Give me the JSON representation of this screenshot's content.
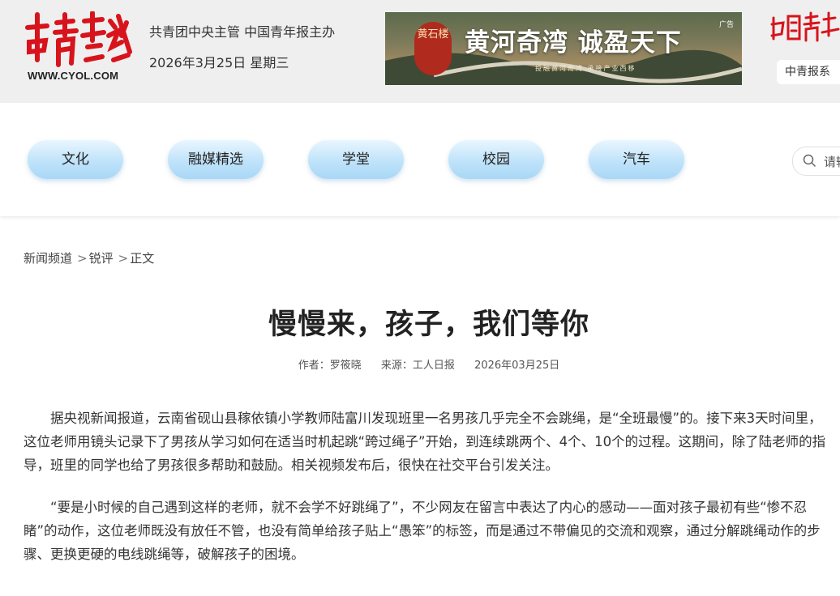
{
  "header": {
    "logo_url": "WWW.CYOL.COM",
    "org_line": "共青团中央主管 中国青年报主办",
    "date_line": "2026年3月25日 星期三",
    "banner": {
      "title": "黄河奇湾 诚盈天下",
      "ad_label": "广告",
      "subtitle": "投融黄河奇湾  承接产业西移",
      "seal_text": "黄石楼"
    },
    "partner_button": "中青报系"
  },
  "nav": {
    "items": [
      "文化",
      "融媒精选",
      "学堂",
      "校园",
      "汽车"
    ],
    "search_placeholder": "请输"
  },
  "breadcrumb": {
    "items": [
      "新闻频道",
      "锐评",
      "正文"
    ],
    "separator": ">"
  },
  "article": {
    "title": "慢慢来，孩子，我们等你",
    "author": "作者：罗筱晓",
    "source": "来源：工人日报",
    "date": "2026年03月25日",
    "paragraphs": [
      "据央视新闻报道，云南省砚山县稼依镇小学教师陆富川发现班里一名男孩几乎完全不会跳绳，是“全班最慢”的。接下来3天时间里，这位老师用镜头记录下了男孩从学习如何在适当时机起跳“跨过绳子”开始，到连续跳两个、4个、10个的过程。这期间，除了陆老师的指导，班里的同学也给了男孩很多帮助和鼓励。相关视频发布后，很快在社交平台引发关注。",
      "“要是小时候的自己遇到这样的老师，就不会学不好跳绳了”，不少网友在留言中表达了内心的感动——面对孩子最初有些“惨不忍睹”的动作，这位老师既没有放任不管，也没有简单给孩子贴上“愚笨”的标签，而是通过不带偏见的交流和观察，通过分解跳绳动作的步骤、更换更硬的电线跳绳等，破解孩子的困境。"
    ]
  },
  "colors": {
    "logo_red": "#d7141c",
    "pill_blue": "#bfe3fa",
    "header_bg": "#efefef"
  }
}
